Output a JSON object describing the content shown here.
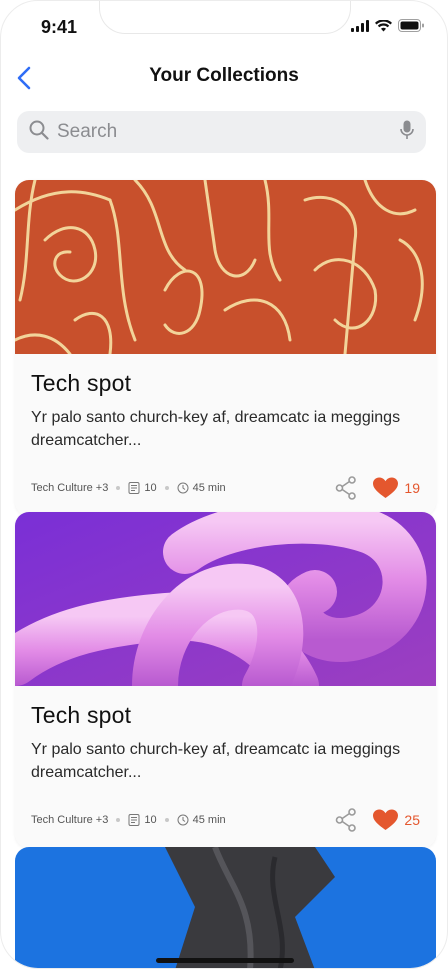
{
  "status_bar": {
    "time": "9:41"
  },
  "header": {
    "title": "Your Collections"
  },
  "search": {
    "placeholder": "Search"
  },
  "cards": [
    {
      "title": "Tech spot",
      "description": "Yr palo santo church-key af, dreamcatc ia meggings dreamcatcher...",
      "category": "Tech Culture +3",
      "items": "10",
      "duration": "45 min",
      "likes": "19"
    },
    {
      "title": "Tech spot",
      "description": "Yr palo santo church-key af, dreamcatc ia meggings dreamcatcher...",
      "category": "Tech Culture +3",
      "items": "10",
      "duration": "45 min",
      "likes": "25"
    }
  ],
  "colors": {
    "accent": "#2f6df6",
    "like": "#e4572e",
    "card1_image": "#c8502c",
    "card2_image": "#8a35c9",
    "card3_image": "#1c73e0"
  }
}
